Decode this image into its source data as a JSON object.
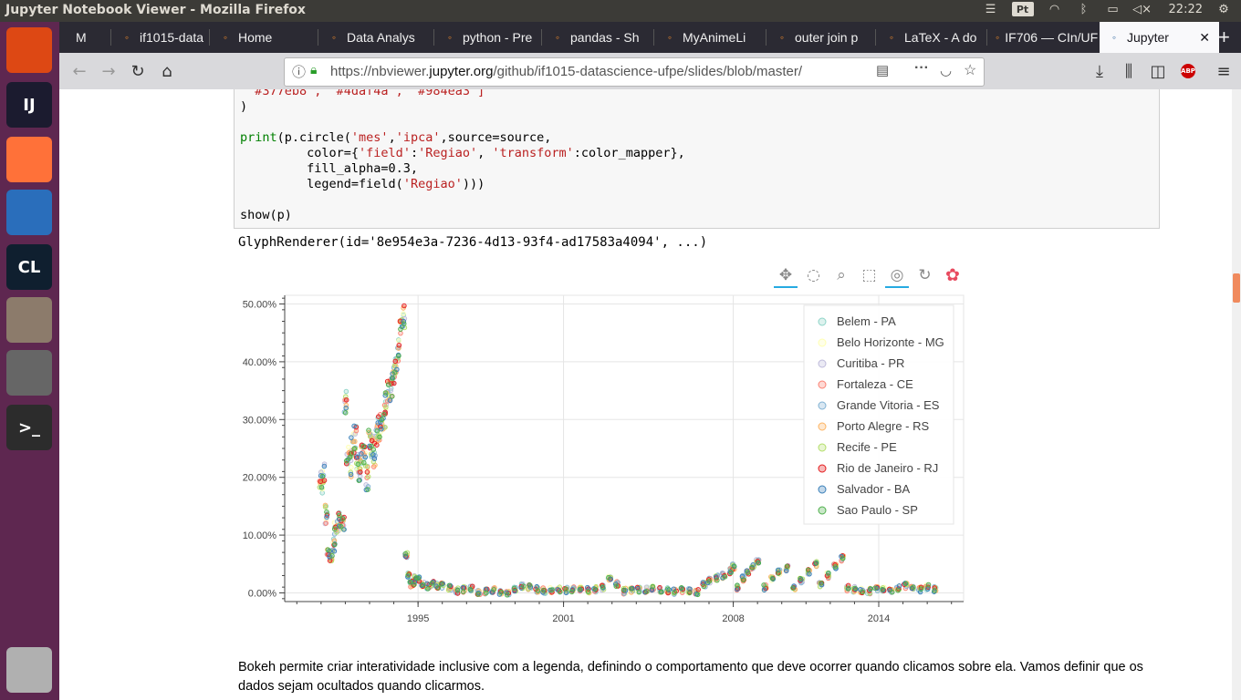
{
  "window_title": "Jupyter Notebook Viewer - Mozilla Firefox",
  "system_tray": {
    "time": "22:22",
    "pt": "Pt"
  },
  "launcher": [
    {
      "name": "ubuntu-dash-icon",
      "label": "",
      "color": "#dd4814"
    },
    {
      "name": "intellij-icon",
      "label": "IJ",
      "color": "#1b1b2f"
    },
    {
      "name": "firefox-icon",
      "label": "",
      "color": "#ff7139"
    },
    {
      "name": "libreoffice-writer-icon",
      "label": "",
      "color": "#2a6ebb"
    },
    {
      "name": "clion-icon",
      "label": "CL",
      "color": "#0f1f2f"
    },
    {
      "name": "file-manager-icon",
      "label": "",
      "color": "#8c7b6b"
    },
    {
      "name": "settings-icon",
      "label": "",
      "color": "#666666"
    },
    {
      "name": "terminal-icon",
      "label": ">_",
      "color": "#2c2c2c"
    },
    {
      "name": "trash-icon",
      "label": "",
      "color": "#b0b0b0"
    }
  ],
  "tabs": [
    {
      "label": "M",
      "icon": "gmail-icon"
    },
    {
      "label": "if1015-data",
      "icon": "tab-icon"
    },
    {
      "label": "Home",
      "icon": "jupyter-icon"
    },
    {
      "label": "Data Analys",
      "icon": "jupyter-icon"
    },
    {
      "label": "python - Pre",
      "icon": "stackoverflow-icon"
    },
    {
      "label": "pandas - Sh",
      "icon": "stackoverflow-icon"
    },
    {
      "label": "MyAnimeLi",
      "icon": "kubernetes-icon"
    },
    {
      "label": "outer join p",
      "icon": "google-icon"
    },
    {
      "label": "LaTeX - A do",
      "icon": "latex-icon"
    },
    {
      "label": "IF706 — CIn/UF",
      "icon": "tab-icon"
    },
    {
      "label": "Jupyter",
      "icon": "nbviewer-icon"
    }
  ],
  "url": {
    "prefix": "https://nbviewer.",
    "domain": "jupyter.org",
    "suffix": "/github/if1015-datascience-ufpe/slides/blob/master/"
  },
  "code_lines": [
    [
      {
        "t": " \"#377eb8\", \"#4daf4a\", \"#984ea3\"]",
        "c": "st"
      }
    ],
    [
      {
        "t": ")",
        "c": ""
      }
    ],
    [
      {
        "t": "",
        "c": ""
      }
    ],
    [
      {
        "t": "print",
        "c": "kw"
      },
      {
        "t": "(p.circle(",
        "c": ""
      },
      {
        "t": "'mes'",
        "c": "st"
      },
      {
        "t": ",",
        "c": ""
      },
      {
        "t": "'ipca'",
        "c": "st"
      },
      {
        "t": ",source=source,",
        "c": ""
      }
    ],
    [
      {
        "t": "         color={",
        "c": ""
      },
      {
        "t": "'field'",
        "c": "st"
      },
      {
        "t": ":",
        "c": ""
      },
      {
        "t": "'Regiao'",
        "c": "st"
      },
      {
        "t": ", ",
        "c": ""
      },
      {
        "t": "'transform'",
        "c": "st"
      },
      {
        "t": ":color_mapper},",
        "c": ""
      }
    ],
    [
      {
        "t": "         fill_alpha=0.3,",
        "c": ""
      }
    ],
    [
      {
        "t": "         legend=field(",
        "c": ""
      },
      {
        "t": "'Regiao'",
        "c": "st"
      },
      {
        "t": ")))",
        "c": ""
      }
    ],
    [
      {
        "t": "",
        "c": ""
      }
    ],
    [
      {
        "t": "show(p)",
        "c": ""
      }
    ]
  ],
  "output_text": "GlyphRenderer(id='8e954e3a-7236-4d13-93f4-ad17583a4094', ...)",
  "bokeh_tools": [
    "pan-tool-icon",
    "lasso-select-icon",
    "box-zoom-icon",
    "box-select-icon",
    "wheel-zoom-icon",
    "reset-icon",
    "bokeh-logo-icon"
  ],
  "chart_data": {
    "type": "scatter",
    "title": "",
    "xlabel": "",
    "ylabel": "",
    "x_ticks": [
      "1995",
      "2001",
      "2008",
      "2014"
    ],
    "x_tick_years": [
      1995,
      2001,
      2008,
      2014
    ],
    "y_ticks": [
      "0.00%",
      "10.00%",
      "20.00%",
      "30.00%",
      "40.00%",
      "50.00%"
    ],
    "xlim": [
      1989.5,
      2017.5
    ],
    "ylim": [
      -1.5,
      51.5
    ],
    "y_unit": "%",
    "legend_position": "top-right",
    "series": [
      {
        "name": "Belem - PA",
        "color": "#8dd3c7"
      },
      {
        "name": "Belo Horizonte - MG",
        "color": "#ffffb3"
      },
      {
        "name": "Curitiba - PR",
        "color": "#bebada"
      },
      {
        "name": "Fortaleza - CE",
        "color": "#fb8072"
      },
      {
        "name": "Grande Vitoria - ES",
        "color": "#80b1d3"
      },
      {
        "name": "Porto Alegre - RS",
        "color": "#fdb462"
      },
      {
        "name": "Recife - PE",
        "color": "#b3de69"
      },
      {
        "name": "Rio de Janeiro - RJ",
        "color": "#e41a1c"
      },
      {
        "name": "Salvador - BA",
        "color": "#377eb8"
      },
      {
        "name": "Sao Paulo - SP",
        "color": "#4daf4a"
      }
    ],
    "approx_monthly_ipca_median": [
      [
        1991.0,
        19.5
      ],
      [
        1991.1,
        21.0
      ],
      [
        1991.2,
        14.0
      ],
      [
        1991.3,
        7.0
      ],
      [
        1991.4,
        6.0
      ],
      [
        1991.5,
        8.5
      ],
      [
        1991.6,
        10.0
      ],
      [
        1991.7,
        12.0
      ],
      [
        1991.8,
        13.0
      ],
      [
        1991.9,
        11.5
      ],
      [
        1992.0,
        33.0
      ],
      [
        1992.1,
        24.0
      ],
      [
        1992.2,
        22.0
      ],
      [
        1992.3,
        25.5
      ],
      [
        1992.4,
        27.0
      ],
      [
        1992.5,
        22.0
      ],
      [
        1992.6,
        21.0
      ],
      [
        1992.7,
        24.0
      ],
      [
        1992.8,
        23.5
      ],
      [
        1992.9,
        20.0
      ],
      [
        1993.0,
        26.0
      ],
      [
        1993.1,
        25.5
      ],
      [
        1993.2,
        24.0
      ],
      [
        1993.3,
        27.5
      ],
      [
        1993.4,
        28.5
      ],
      [
        1993.5,
        29.0
      ],
      [
        1993.6,
        30.5
      ],
      [
        1993.7,
        33.0
      ],
      [
        1993.8,
        35.0
      ],
      [
        1993.9,
        36.0
      ],
      [
        1994.0,
        38.0
      ],
      [
        1994.1,
        40.0
      ],
      [
        1994.2,
        42.0
      ],
      [
        1994.3,
        45.5
      ],
      [
        1994.4,
        47.5
      ],
      [
        1994.5,
        6.5
      ],
      [
        1994.6,
        3.0
      ],
      [
        1994.7,
        1.5
      ],
      [
        1994.8,
        1.8
      ],
      [
        1994.9,
        2.5
      ],
      [
        1995.0,
        2.5
      ],
      [
        1995.2,
        1.5
      ],
      [
        1995.4,
        1.2
      ],
      [
        1995.6,
        1.5
      ],
      [
        1995.8,
        1.2
      ],
      [
        1996.0,
        1.3
      ],
      [
        1996.3,
        0.8
      ],
      [
        1996.6,
        0.4
      ],
      [
        1996.9,
        0.6
      ],
      [
        1997.2,
        0.7
      ],
      [
        1997.5,
        0.2
      ],
      [
        1997.8,
        0.3
      ],
      [
        1998.1,
        0.5
      ],
      [
        1998.4,
        0.1
      ],
      [
        1998.7,
        -0.2
      ],
      [
        1999.0,
        0.8
      ],
      [
        1999.3,
        1.2
      ],
      [
        1999.6,
        0.9
      ],
      [
        1999.9,
        0.6
      ],
      [
        2000.2,
        0.4
      ],
      [
        2000.5,
        0.5
      ],
      [
        2000.8,
        0.6
      ],
      [
        2001.1,
        0.5
      ],
      [
        2001.4,
        0.6
      ],
      [
        2001.7,
        0.7
      ],
      [
        2002.0,
        0.5
      ],
      [
        2002.3,
        0.6
      ],
      [
        2002.6,
        0.9
      ],
      [
        2002.9,
        2.5
      ],
      [
        2003.2,
        1.6
      ],
      [
        2003.5,
        0.3
      ],
      [
        2003.8,
        0.4
      ],
      [
        2004.1,
        0.6
      ],
      [
        2004.4,
        0.5
      ],
      [
        2004.7,
        0.7
      ],
      [
        2005.0,
        0.6
      ],
      [
        2005.3,
        0.5
      ],
      [
        2005.6,
        0.2
      ],
      [
        2005.9,
        0.4
      ],
      [
        2006.2,
        0.4
      ],
      [
        2006.5,
        0.2
      ],
      [
        2006.8,
        1.5
      ],
      [
        2007.0,
        2.2
      ],
      [
        2007.3,
        2.6
      ],
      [
        2007.6,
        3.0
      ],
      [
        2007.9,
        3.8
      ],
      [
        2008.0,
        4.5
      ],
      [
        2008.2,
        0.9
      ],
      [
        2008.4,
        2.5
      ],
      [
        2008.6,
        3.5
      ],
      [
        2008.8,
        4.6
      ],
      [
        2009.0,
        5.5
      ],
      [
        2009.3,
        1.0
      ],
      [
        2009.6,
        2.3
      ],
      [
        2009.9,
        3.5
      ],
      [
        2010.2,
        4.3
      ],
      [
        2010.5,
        1.0
      ],
      [
        2010.8,
        2.2
      ],
      [
        2011.1,
        3.6
      ],
      [
        2011.4,
        5.0
      ],
      [
        2011.6,
        1.4
      ],
      [
        2011.9,
        3.0
      ],
      [
        2012.2,
        4.5
      ],
      [
        2012.5,
        6.0
      ],
      [
        2012.7,
        0.8
      ],
      [
        2013.0,
        0.6
      ],
      [
        2013.3,
        0.5
      ],
      [
        2013.6,
        0.3
      ],
      [
        2013.9,
        0.7
      ],
      [
        2014.2,
        0.6
      ],
      [
        2014.5,
        0.5
      ],
      [
        2014.8,
        0.9
      ],
      [
        2015.1,
        1.2
      ],
      [
        2015.4,
        0.7
      ],
      [
        2015.7,
        0.5
      ],
      [
        2016.0,
        1.0
      ],
      [
        2016.3,
        0.6
      ]
    ]
  },
  "paragraph": "Bokeh permite criar interatividade inclusive com a legenda, definindo o comportamento que deve ocorrer quando clicamos sobre ela. Vamos definir que os dados sejam ocultados quando clicarmos."
}
